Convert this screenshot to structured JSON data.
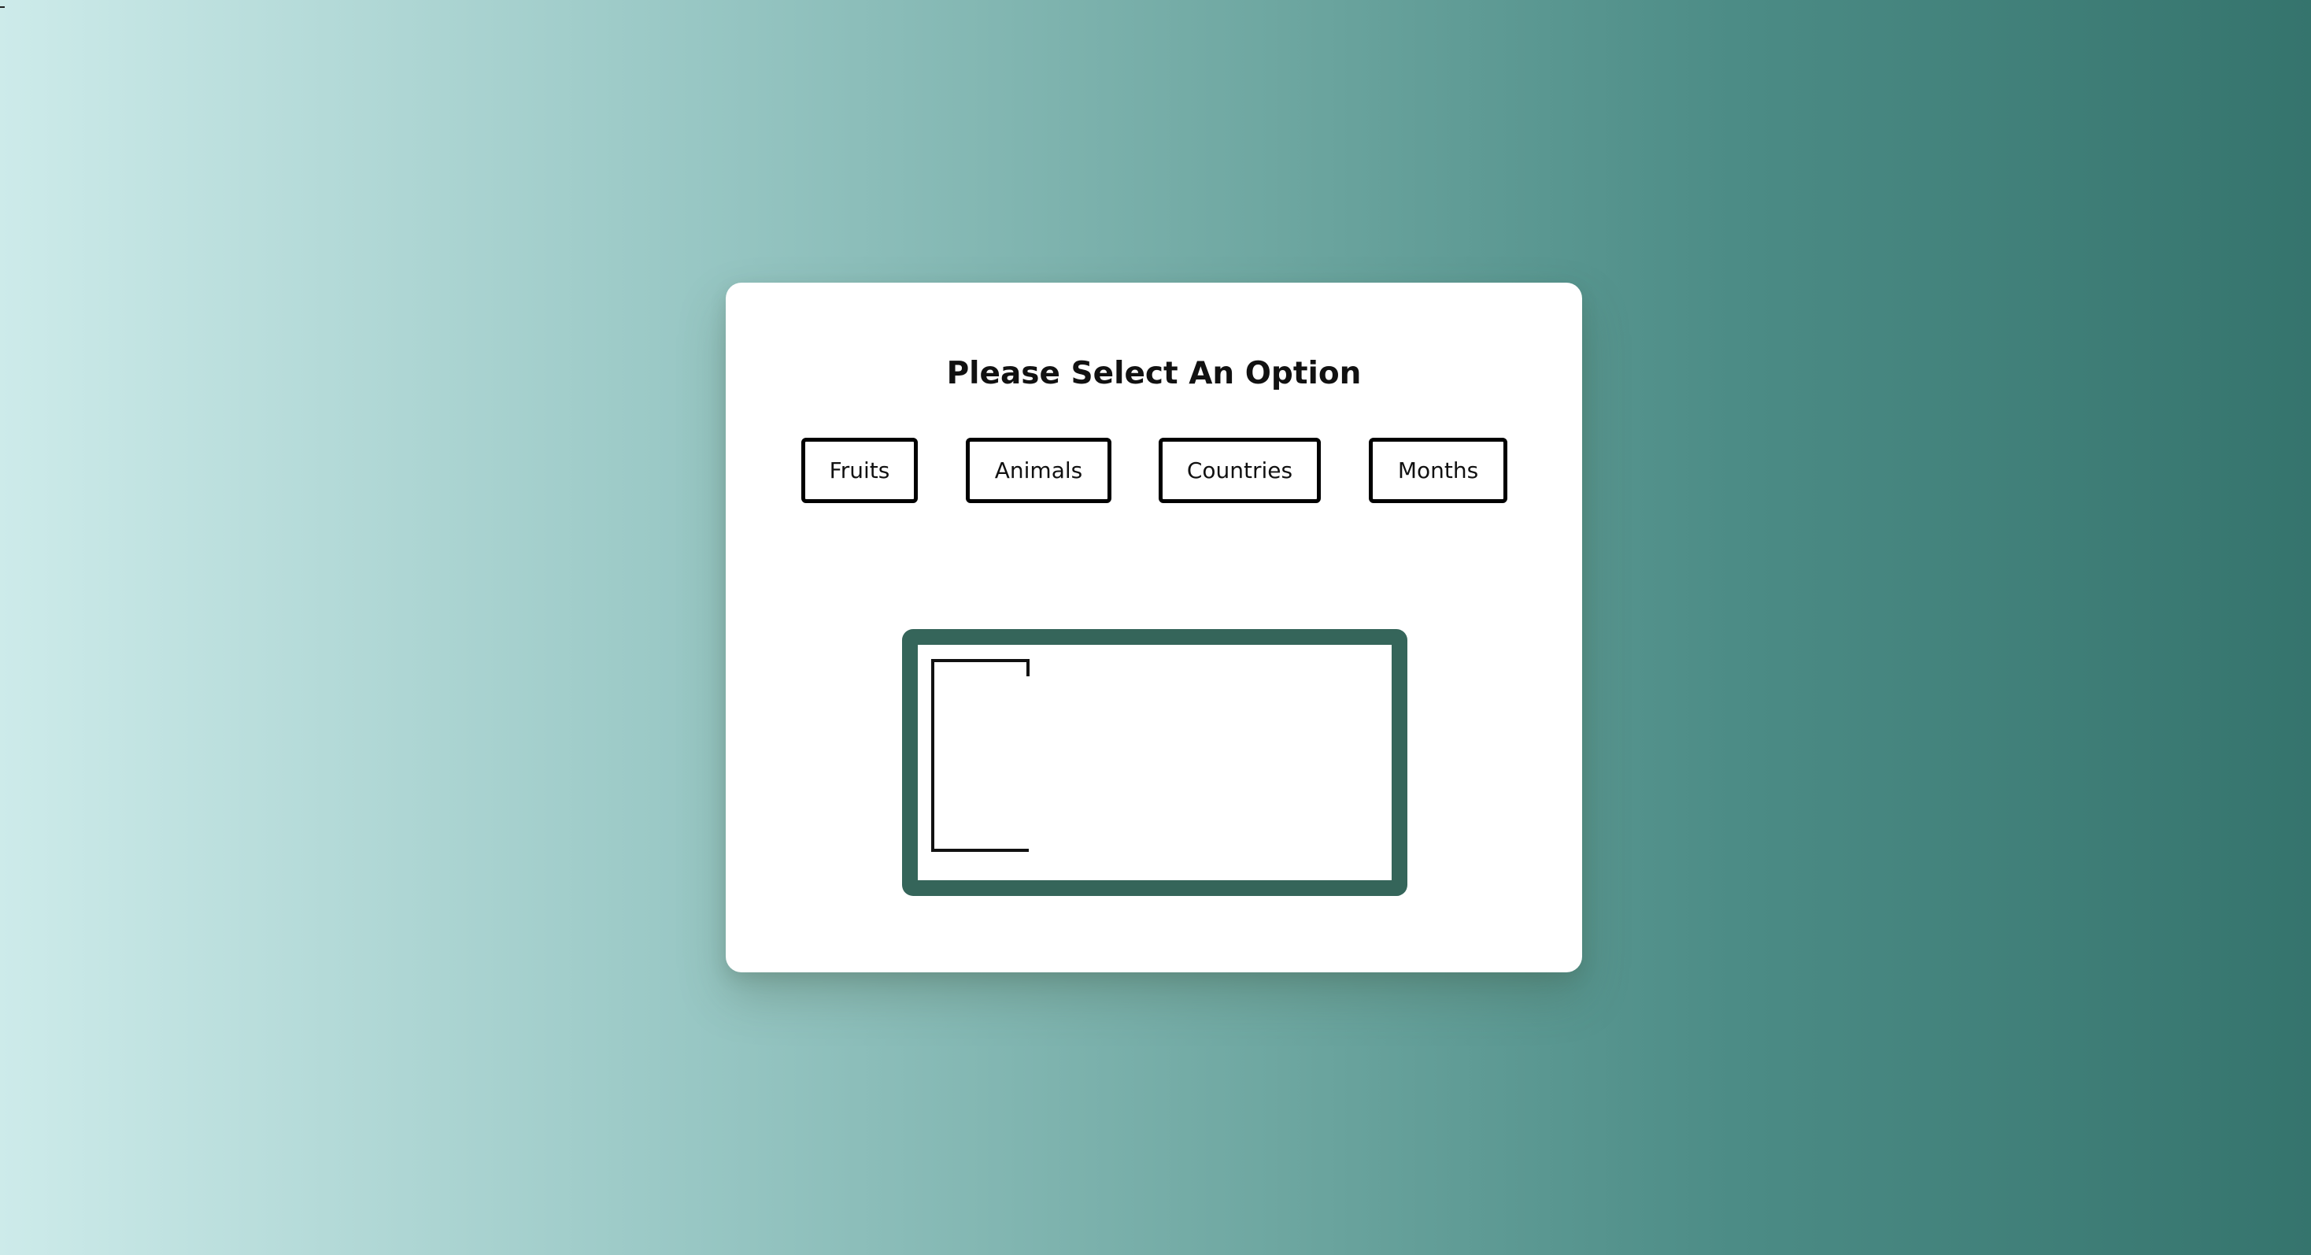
{
  "page": {
    "title": "Please Select An Option"
  },
  "options": [
    {
      "label": "Fruits"
    },
    {
      "label": "Animals"
    },
    {
      "label": "Countries"
    },
    {
      "label": "Months"
    }
  ],
  "colors": {
    "background_left": "#cdebea",
    "background_right": "#35746d",
    "card": "#ffffff",
    "frame": "#35655a",
    "button_border": "#000000"
  },
  "icons": {
    "display_drawing": "open-rectangle-drawing"
  }
}
